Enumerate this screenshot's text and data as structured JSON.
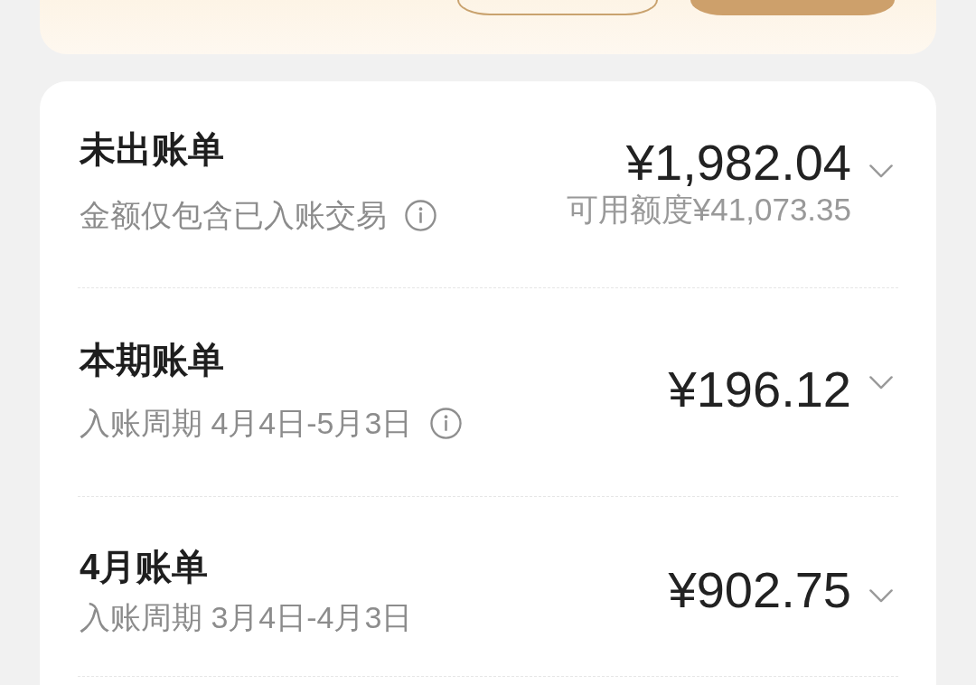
{
  "top_panel": {
    "buttons": [
      {
        "kind": "outlined"
      },
      {
        "kind": "filled"
      }
    ]
  },
  "bills": [
    {
      "title": "未出账单",
      "subtitle": "金额仅包含已入账交易",
      "info": true,
      "amount": "¥1,982.04",
      "note": "可用额度¥41,073.35",
      "expanded": false
    },
    {
      "title": "本期账单",
      "subtitle": "入账周期 4月4日-5月3日",
      "info": true,
      "amount": "¥196.12",
      "expanded": false
    },
    {
      "title": "4月账单",
      "subtitle": "入账周期 3月4日-4月3日",
      "info": false,
      "amount": "¥902.75",
      "expanded": false
    }
  ]
}
